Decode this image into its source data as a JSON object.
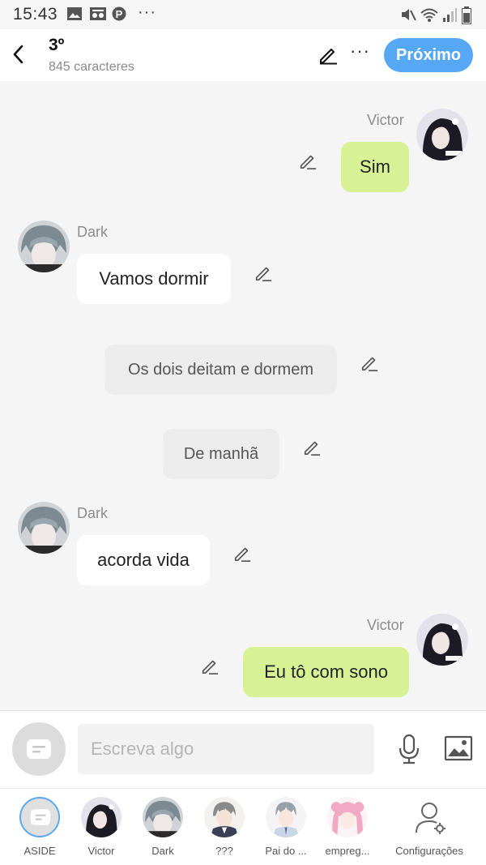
{
  "status_bar": {
    "time": "15:43",
    "left_icons": [
      "image-icon",
      "voicemail-icon",
      "pinterest-icon",
      "more-icon"
    ],
    "right_icons": [
      "mute-icon",
      "wifi-icon",
      "signal-icon",
      "battery-icon"
    ]
  },
  "header": {
    "title": "3º",
    "subtitle": "845 caracteres",
    "next_label": "Próximo"
  },
  "messages": [
    {
      "type": "me",
      "sender": "Victor",
      "text": "Sim"
    },
    {
      "type": "other",
      "sender": "Dark",
      "text": "Vamos dormir"
    },
    {
      "type": "narration",
      "text": "Os dois deitam e dormem"
    },
    {
      "type": "narration",
      "text": "De manhã"
    },
    {
      "type": "other",
      "sender": "Dark",
      "text": "acorda vida"
    },
    {
      "type": "me",
      "sender": "Victor",
      "text": "Eu tô com sono"
    }
  ],
  "input": {
    "placeholder": "Escreva algo"
  },
  "tabs": [
    {
      "label": "ASIDE"
    },
    {
      "label": "Victor"
    },
    {
      "label": "Dark"
    },
    {
      "label": "???"
    },
    {
      "label": "Pai do ..."
    },
    {
      "label": "empreg..."
    },
    {
      "label": "Configurações"
    }
  ],
  "colors": {
    "accent": "#57a8f4",
    "my_bubble": "#d8f195",
    "other_bubble": "#ffffff",
    "narration_bubble": "#ececec",
    "background": "#f5f5f5"
  }
}
